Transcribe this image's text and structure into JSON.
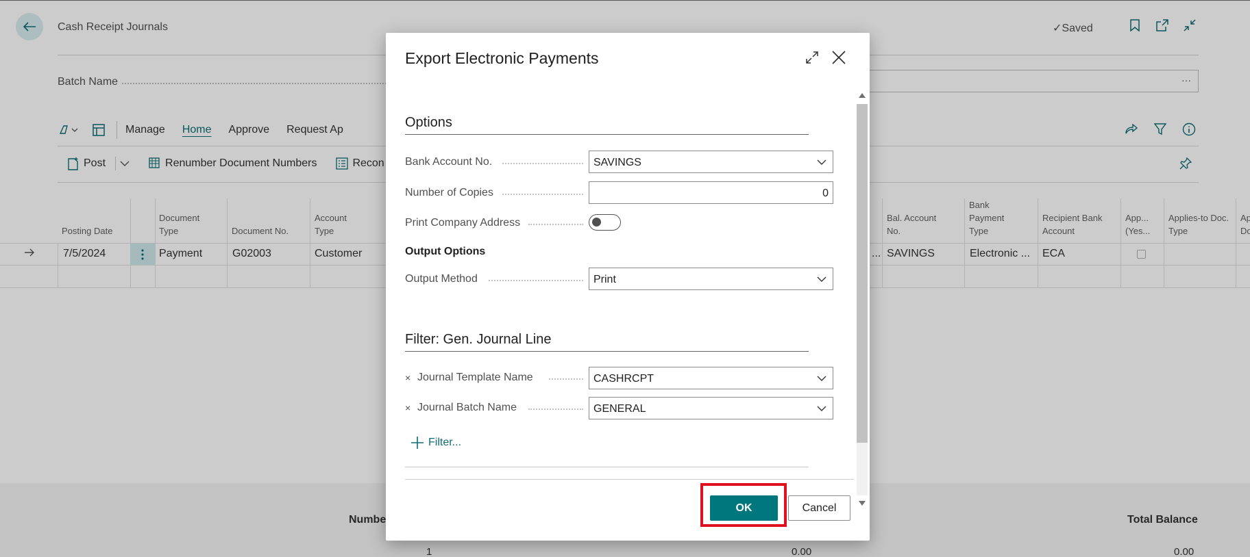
{
  "page": {
    "title": "Cash Receipt Journals",
    "saved_label": "Saved",
    "batch_label": "Batch Name",
    "batch_more": "···",
    "menus": [
      "Manage",
      "Home",
      "Approve",
      "Request Ap"
    ],
    "active_menu": "Home",
    "actions": {
      "post": "Post",
      "renumber": "Renumber Document Numbers",
      "reconcile": "Recon"
    },
    "columns": {
      "posting_date": "Posting Date",
      "document_type": "Document Type",
      "document_no": "Document No.",
      "account_type": "Account Type",
      "bal_account_no": "Bal. Account No.",
      "bank_payment_type": "Bank Payment Type",
      "recipient_bank_account": "Recipient Bank Account",
      "app_yes": "App... (Yes...",
      "applies_to_doc_type": "Applies-to Doc. Type",
      "ap_cut": "Ap Do"
    },
    "row": {
      "posting_date": "7/5/2024",
      "document_type": "Payment",
      "document_no": "G02003",
      "account_type": "Customer",
      "bal_ellipsis": "...",
      "bal_account_no": "SAVINGS",
      "bank_payment_type": "Electronic ...",
      "recipient_bank_account": "ECA"
    },
    "footer": {
      "number_label": "Numbe",
      "total_label": "Total Balance",
      "number_value": "1",
      "mid_value": "0.00",
      "total_value": "0.00"
    }
  },
  "dialog": {
    "title": "Export Electronic Payments",
    "options_title": "Options",
    "fields": {
      "bank_account_label": "Bank Account No.",
      "bank_account_value": "SAVINGS",
      "copies_label": "Number of Copies",
      "copies_value": "0",
      "print_address_label": "Print Company Address",
      "print_address_on": false
    },
    "output_title": "Output Options",
    "output_method_label": "Output Method",
    "output_method_value": "Print",
    "filter_title": "Filter: Gen. Journal Line",
    "filters": {
      "template_label": "Journal Template Name",
      "template_value": "CASHRCPT",
      "batch_label": "Journal Batch Name",
      "batch_value": "GENERAL",
      "remove_glyph": "×"
    },
    "add_filter_label": "Filter...",
    "ok_label": "OK",
    "cancel_label": "Cancel"
  },
  "colors": {
    "accent": "#00767d",
    "highlight": "#e0101f"
  }
}
